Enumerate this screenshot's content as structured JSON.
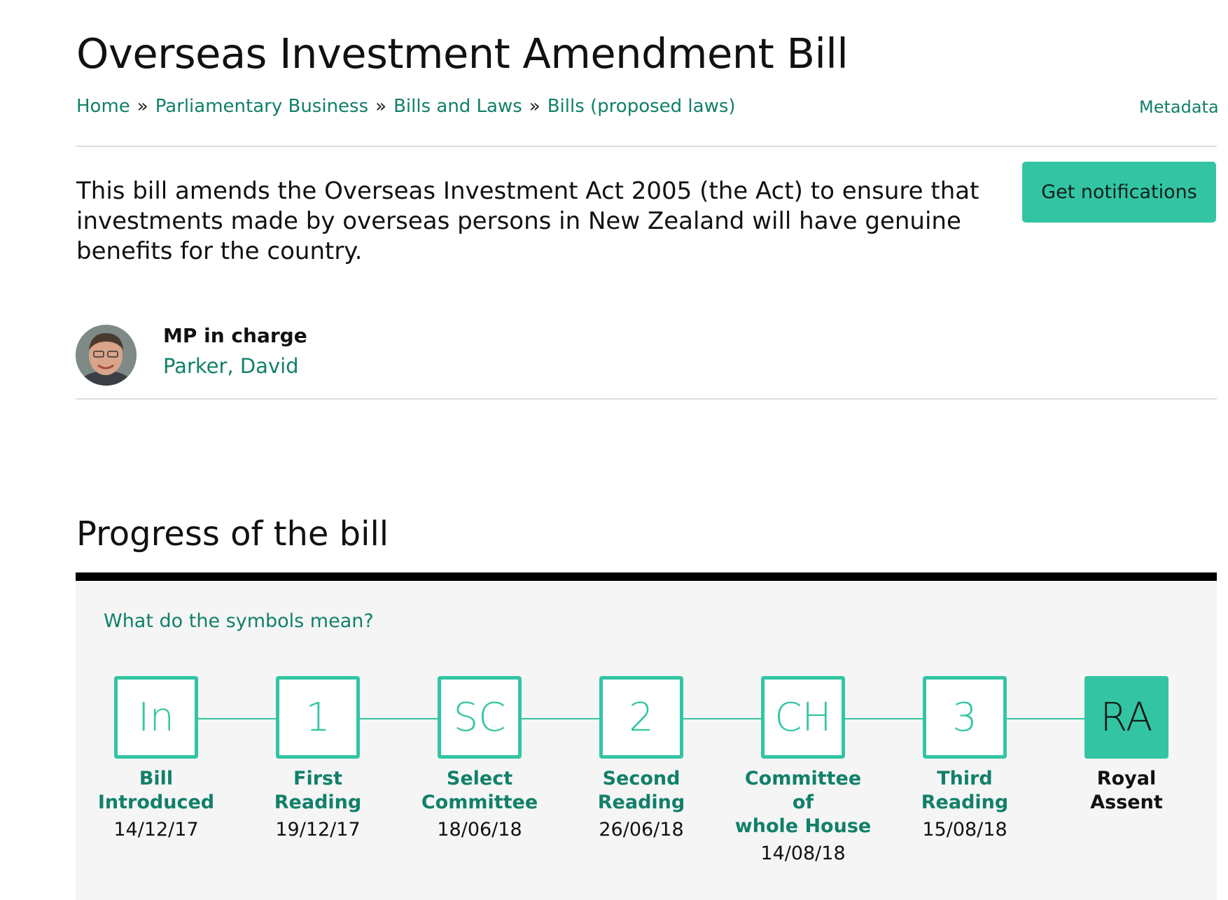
{
  "page": {
    "title": "Overseas Investment Amendment Bill",
    "breadcrumb": [
      "Home",
      "Parliamentary Business",
      "Bills and Laws",
      "Bills (proposed laws)"
    ],
    "breadcrumb_separator": "»",
    "metadata_link": "Metadata"
  },
  "summary": {
    "text": "This bill amends the Overseas Investment Act 2005 (the Act) to ensure that investments made by overseas persons in New Zealand will have genuine benefits for the country.",
    "notify_button": "Get notifications"
  },
  "mp": {
    "label": "MP in charge",
    "name": "Parker, David"
  },
  "progress": {
    "heading": "Progress of the bill",
    "symbols_link": "What do the symbols mean?",
    "stages": [
      {
        "symbol": "In",
        "line1": "Bill",
        "line2": "Introduced",
        "line3": "",
        "date": "14/12/17",
        "current": false
      },
      {
        "symbol": "1",
        "line1": "First",
        "line2": "Reading",
        "line3": "",
        "date": "19/12/17",
        "current": false
      },
      {
        "symbol": "SC",
        "line1": "Select",
        "line2": "Committee",
        "line3": "",
        "date": "18/06/18",
        "current": false
      },
      {
        "symbol": "2",
        "line1": "Second",
        "line2": "Reading",
        "line3": "",
        "date": "26/06/18",
        "current": false
      },
      {
        "symbol": "CH",
        "line1": "Committee",
        "line2": "of",
        "line3": "whole House",
        "date": "14/08/18",
        "current": false
      },
      {
        "symbol": "3",
        "line1": "Third",
        "line2": "Reading",
        "line3": "",
        "date": "15/08/18",
        "current": false
      },
      {
        "symbol": "RA",
        "line1": "Royal",
        "line2": "Assent",
        "line3": "",
        "date": "",
        "current": true
      }
    ]
  },
  "colors": {
    "accent": "#33c5a3",
    "link": "#11806a",
    "panel": "#f5f5f5"
  },
  "icons": {
    "avatar": "mp-portrait-photo"
  }
}
